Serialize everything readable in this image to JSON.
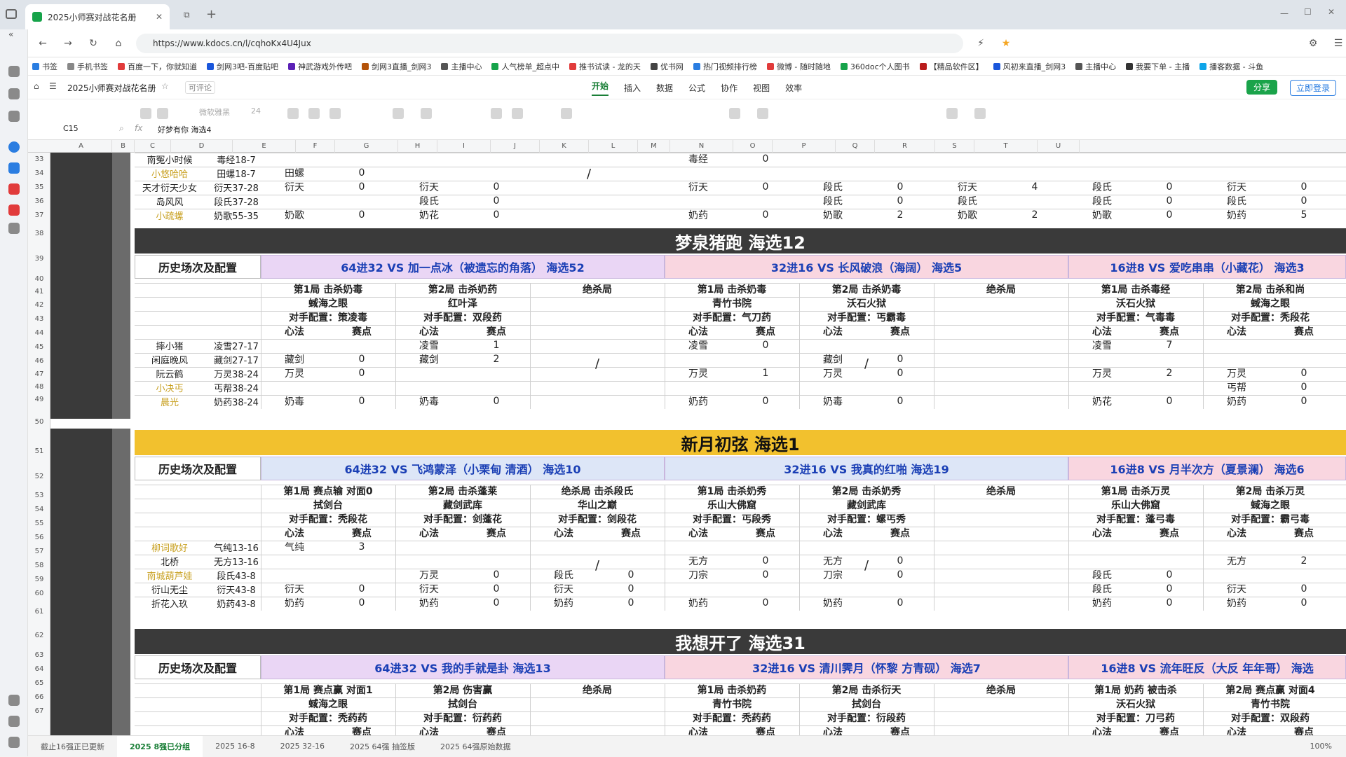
{
  "browser": {
    "tab_title": "2025小师赛对战花名册",
    "url": "https://www.kdocs.cn/l/cqhoKx4U4Jux",
    "bookmarks": [
      "书签",
      "手机书签",
      "百度一下，你就知道",
      "剑网3吧-百度贴吧",
      "神武游戏外传吧",
      "剑网3直播_剑网3",
      "主播中心",
      "人气榜单_超点中",
      "推书试读 - 龙的天",
      "优书网",
      "热门视频排行榜",
      "微博 - 随时随地",
      "360doc个人图书",
      "【精品软件区】",
      "风初来直播_剑网3",
      "主播中心",
      "我要下单 - 主播",
      "播客数据 - 斗鱼"
    ]
  },
  "app": {
    "doc_title": "2025小师赛对战花名册",
    "comment_label": "可评论",
    "share_label": "分享",
    "login_label": "立即登录",
    "menu_tabs": [
      "开始",
      "插入",
      "数据",
      "公式",
      "协作",
      "视图",
      "效率"
    ],
    "active_tab": "开始",
    "cell_ref": "C15",
    "formula_value": "好梦有你 海选4",
    "font_name": "微软雅黑",
    "font_size": "24"
  },
  "sheet": {
    "columns": [
      "A",
      "B",
      "C",
      "D",
      "E",
      "F",
      "G",
      "H",
      "I",
      "J",
      "K",
      "L",
      "M",
      "N",
      "O",
      "P",
      "Q",
      "R",
      "S",
      "T",
      "U"
    ],
    "rows": [
      "33",
      "34",
      "35",
      "36",
      "37",
      "38",
      "39",
      "40",
      "41",
      "42",
      "43",
      "44",
      "45",
      "46",
      "47",
      "48",
      "49",
      "50",
      "51",
      "52",
      "53",
      "54",
      "55",
      "56",
      "57",
      "58",
      "59",
      "60",
      "61",
      "62",
      "63",
      "64",
      "65",
      "66",
      "67"
    ],
    "top_block": {
      "players": [
        {
          "name": "南冤小时候",
          "cfg": "毒经18-7",
          "gold": false
        },
        {
          "name": "小悠哈哈",
          "cfg": "田螺18-7",
          "gold": true
        },
        {
          "name": "天才衍天少女",
          "cfg": "衍天37-28",
          "gold": false
        },
        {
          "name": "岛风风",
          "cfg": "段氏37-28",
          "gold": false
        },
        {
          "name": "小疏螺",
          "cfg": "奶歌55-35",
          "gold": true
        }
      ],
      "g1": [
        [
          "",
          ""
        ],
        [
          "田螺",
          "0"
        ],
        [
          "衍天",
          "0"
        ],
        [
          "",
          ""
        ],
        [
          "奶歌",
          "0"
        ]
      ],
      "g2": [
        [
          "",
          ""
        ],
        [
          "",
          ""
        ],
        [
          "衍天",
          "0"
        ],
        [
          "段氏",
          "0"
        ],
        [
          "奶花",
          "0"
        ]
      ],
      "g4": [
        [
          "毒经",
          "0"
        ],
        [
          "",
          ""
        ],
        [
          "衍天",
          "0"
        ],
        [
          "",
          ""
        ],
        [
          "奶药",
          "0"
        ]
      ],
      "g5": [
        [
          "",
          ""
        ],
        [
          "",
          ""
        ],
        [
          "段氏",
          "0"
        ],
        [
          "段氏",
          "0"
        ],
        [
          "奶歌",
          "2"
        ]
      ],
      "g6": [
        [
          "",
          ""
        ],
        [
          "",
          ""
        ],
        [
          "衍天",
          "4"
        ],
        [
          "段氏",
          ""
        ],
        [
          "奶歌",
          "2"
        ]
      ],
      "g7": [
        [
          "",
          ""
        ],
        [
          "",
          ""
        ],
        [
          "段氏",
          "0"
        ],
        [
          "段氏",
          "0"
        ],
        [
          "奶歌",
          "0"
        ]
      ],
      "g8": [
        [
          "",
          ""
        ],
        [
          "",
          ""
        ],
        [
          "衍天",
          "0"
        ],
        [
          "段氏",
          "0"
        ],
        [
          "奶药",
          "5"
        ]
      ],
      "g9": [
        [
          "毒经",
          ""
        ],
        [
          "田螺",
          ""
        ],
        [
          "",
          ""
        ],
        [
          "",
          ""
        ],
        [
          "奶歌",
          ""
        ]
      ]
    },
    "blocks": [
      {
        "team": "梦泉猪跑 海选12",
        "bar_color": "#3a3a3a",
        "bar_text_color": "#ffffff",
        "history_label": "历史场次及配置",
        "matches": [
          {
            "text": "64进32 VS 加一点冰（被遗忘的角落） 海选52",
            "bg": "#ead6f5"
          },
          {
            "text": "32进16 VS 长风破浪（海阔） 海选5",
            "bg": "#f9d6e0"
          },
          {
            "text": "16进8 VS 爱吃串串（小藏花） 海选3",
            "bg": "#f9d6e0"
          }
        ],
        "games": [
          "第1局 击杀奶毒",
          "第2局 击杀奶药",
          "绝杀局",
          "第1局 击杀奶毒",
          "第2局 击杀奶毒",
          "绝杀局",
          "第1局 击杀毒经",
          "第2局 击杀和尚"
        ],
        "maps": [
          "蜮海之眼",
          "红叶泽",
          "",
          "青竹书院",
          "沃石火狱",
          "",
          "沃石火狱",
          "蜮海之眼"
        ],
        "opp_cfg": [
          "对手配置：策凌毒",
          "对手配置：双段药",
          "",
          "对手配置：气刀药",
          "对手配置：丐霸毒",
          "",
          "对手配置：气毒毒",
          "对手配置：秃段花"
        ],
        "col_labels": [
          "心法",
          "赛点"
        ],
        "players": [
          {
            "name": "摔小猪",
            "cfg": "凌雪27-17",
            "gold": false
          },
          {
            "name": "闲庭晚风",
            "cfg": "藏剑27-17",
            "gold": false
          },
          {
            "name": "阮云鹤",
            "cfg": "万灵38-24",
            "gold": false
          },
          {
            "name": "小决丐",
            "cfg": "丐帮38-24",
            "gold": true
          },
          {
            "name": "晨光",
            "cfg": "奶药38-24",
            "gold": true
          }
        ],
        "g1": [
          [
            "",
            ""
          ],
          [
            "藏剑",
            "0"
          ],
          [
            "万灵",
            "0"
          ],
          [
            "",
            ""
          ],
          [
            "奶毒",
            "0"
          ]
        ],
        "g2": [
          [
            "凌雪",
            "1"
          ],
          [
            "藏剑",
            "2"
          ],
          [
            "",
            ""
          ],
          [
            "",
            ""
          ],
          [
            "奶毒",
            "0"
          ]
        ],
        "g4": [
          [
            "凌雪",
            "0"
          ],
          [
            "",
            ""
          ],
          [
            "万灵",
            "1"
          ],
          [
            "",
            ""
          ],
          [
            "奶药",
            "0"
          ]
        ],
        "g5": [
          [
            "",
            ""
          ],
          [
            "藏剑",
            "0"
          ],
          [
            "万灵",
            "0"
          ],
          [
            "",
            ""
          ],
          [
            "奶毒",
            "0"
          ]
        ],
        "g7": [
          [
            "凌雪",
            "7"
          ],
          [
            "",
            ""
          ],
          [
            "万灵",
            "2"
          ],
          [
            "",
            ""
          ],
          [
            "奶花",
            "0"
          ]
        ],
        "g8": [
          [
            "",
            ""
          ],
          [
            "",
            ""
          ],
          [
            "万灵",
            "0"
          ],
          [
            "丐帮",
            "0"
          ],
          [
            "奶药",
            "0"
          ]
        ],
        "slash": "/"
      },
      {
        "team": "新月初弦 海选1",
        "bar_color": "#f2c12e",
        "bar_text_color": "#111111",
        "history_label": "历史场次及配置",
        "matches": [
          {
            "text": "64进32 VS 飞鸿蒙泽（小栗甸 清酒） 海选10",
            "bg": "#dde6f7"
          },
          {
            "text": "32进16 VS 我真的红啪 海选19",
            "bg": "#dde6f7"
          },
          {
            "text": "16进8 VS 月半次方（夏景澜） 海选6",
            "bg": "#f9d6e0"
          }
        ],
        "games": [
          "第1局 赛点输 对面0",
          "第2局 击杀蓬莱",
          "绝杀局 击杀段氏",
          "第1局 击杀奶秀",
          "第2局 击杀奶秀",
          "绝杀局",
          "第1局 击杀万灵",
          "第2局 击杀万灵"
        ],
        "maps": [
          "拭剑台",
          "藏剑武库",
          "华山之巅",
          "乐山大佛窟",
          "藏剑武库",
          "",
          "乐山大佛窟",
          "蜮海之眼"
        ],
        "opp_cfg": [
          "对手配置：秃段花",
          "对手配置：剑蓬花",
          "对手配置：剑段花",
          "对手配置：丐段秀",
          "对手配置：螺丐秀",
          "",
          "对手配置：蓬弓毒",
          "对手配置：霸弓毒"
        ],
        "col_labels": [
          "心法",
          "赛点"
        ],
        "players": [
          {
            "name": "柳词歌好",
            "cfg": "气纯13-16",
            "gold": true
          },
          {
            "name": "北桥",
            "cfg": "无方13-16",
            "gold": false
          },
          {
            "name": "南城葫芦娃",
            "cfg": "段氏43-8",
            "gold": true
          },
          {
            "name": "衍山无尘",
            "cfg": "衍天43-8",
            "gold": false
          },
          {
            "name": "折花入玖",
            "cfg": "奶药43-8",
            "gold": false
          }
        ],
        "g1": [
          [
            "气纯",
            "3"
          ],
          [
            "",
            ""
          ],
          [
            "",
            ""
          ],
          [
            "衍天",
            "0"
          ],
          [
            "奶药",
            "0"
          ]
        ],
        "g2": [
          [
            "",
            ""
          ],
          [
            "",
            ""
          ],
          [
            "万灵",
            "0"
          ],
          [
            "衍天",
            "0"
          ],
          [
            "奶药",
            "0"
          ]
        ],
        "g3": [
          [
            "",
            ""
          ],
          [
            "",
            ""
          ],
          [
            "段氏",
            "0"
          ],
          [
            "衍天",
            "0"
          ],
          [
            "奶药",
            "0"
          ]
        ],
        "g4": [
          [
            "",
            ""
          ],
          [
            "无方",
            "0"
          ],
          [
            "刀宗",
            "0"
          ],
          [
            "",
            ""
          ],
          [
            "奶药",
            "0"
          ]
        ],
        "g5": [
          [
            "",
            ""
          ],
          [
            "无方",
            "0"
          ],
          [
            "刀宗",
            "0"
          ],
          [
            "",
            ""
          ],
          [
            "奶药",
            "0"
          ]
        ],
        "g7": [
          [
            "",
            ""
          ],
          [
            "",
            ""
          ],
          [
            "段氏",
            "0"
          ],
          [
            "段氏",
            "0"
          ],
          [
            "奶药",
            "0"
          ]
        ],
        "g8": [
          [
            "",
            ""
          ],
          [
            "无方",
            "2"
          ],
          [
            "",
            ""
          ],
          [
            "衍天",
            "0"
          ],
          [
            "奶药",
            "0"
          ]
        ],
        "slash": "/"
      },
      {
        "team": "我想开了 海选31",
        "bar_color": "#3a3a3a",
        "bar_text_color": "#ffffff",
        "history_label": "历史场次及配置",
        "matches": [
          {
            "text": "64进32 VS 我的手就是卦 海选13",
            "bg": "#ead6f5"
          },
          {
            "text": "32进16 VS 清川霁月（怀黎 方青砚） 海选7",
            "bg": "#f9d6e0"
          },
          {
            "text": "16进8 VS 流年旺反（大反 年年哥） 海选",
            "bg": "#f9d6e0"
          }
        ],
        "games": [
          "第1局 赛点赢 对面1",
          "第2局 伤害赢",
          "绝杀局",
          "第1局 击杀奶药",
          "第2局 击杀衍天",
          "绝杀局",
          "第1局 奶药 被击杀",
          "第2局 赛点赢 对面4"
        ],
        "maps": [
          "蜮海之眼",
          "拭剑台",
          "",
          "青竹书院",
          "拭剑台",
          "",
          "沃石火狱",
          "青竹书院"
        ],
        "opp_cfg": [
          "对手配置：秃药药",
          "对手配置：衍药药",
          "",
          "对手配置：秃药药",
          "对手配置：衍段药",
          "",
          "对手配置：刀弓药",
          "对手配置：双段药"
        ],
        "col_labels": [
          "心法",
          "赛点"
        ]
      }
    ]
  },
  "bottom_tabs": [
    "截止16强正已更新",
    "2025 8强已分组",
    "2025 16-8",
    "2025 32-16",
    "2025 64强 抽签版",
    "2025 64强原始数据"
  ],
  "active_bottom_tab": "2025 8强已分组",
  "zoom": "100%"
}
